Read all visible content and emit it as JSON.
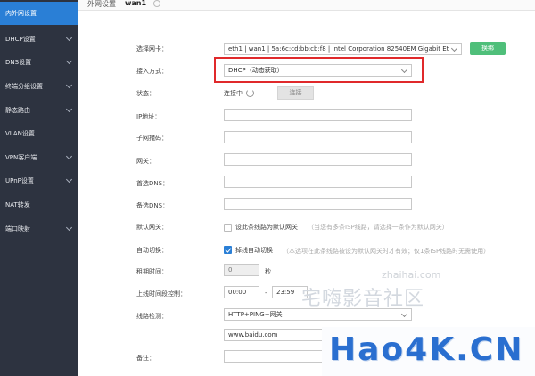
{
  "header": {
    "title": "外网设置",
    "wan": "wan1"
  },
  "sidebar": {
    "items": [
      {
        "label": "内外网设置",
        "active": true,
        "has_chevron": false
      },
      {
        "label": "DHCP设置",
        "has_chevron": true
      },
      {
        "label": "DNS设置",
        "has_chevron": true
      },
      {
        "label": "终端分组设置",
        "has_chevron": true
      },
      {
        "label": "静态路由",
        "has_chevron": true
      },
      {
        "label": "VLAN设置",
        "has_chevron": false
      },
      {
        "label": "VPN客户端",
        "has_chevron": true
      },
      {
        "label": "UPnP设置",
        "has_chevron": true
      },
      {
        "label": "NAT转发",
        "has_chevron": false
      },
      {
        "label": "端口映射",
        "has_chevron": true
      }
    ]
  },
  "form": {
    "nic": {
      "label": "选择网卡：",
      "value": "eth1 | wan1 | 5a:6c:cd:bb:cb:f8 | Intel Corporation 82540EM Gigabit Et",
      "button": "换绑"
    },
    "access": {
      "label": "接入方式：",
      "value": "DHCP（动态获取）"
    },
    "status": {
      "label": "状态：",
      "value": "连接中",
      "button": "连接"
    },
    "ip": {
      "label": "IP地址：",
      "value": ""
    },
    "mask": {
      "label": "子网掩码：",
      "value": ""
    },
    "gateway": {
      "label": "网关：",
      "value": ""
    },
    "dns1": {
      "label": "首选DNS：",
      "value": ""
    },
    "dns2": {
      "label": "备选DNS：",
      "value": ""
    },
    "default_gw": {
      "label": "默认网关：",
      "checkbox_label": "设此条线路为默认网关",
      "hint": "（当您有多条ISP线路，请选择一条作为默认网关）",
      "checked": false
    },
    "auto_switch": {
      "label": "自动切换：",
      "checkbox_label": "掉线自动切换",
      "hint": "（本选项在此条线路被设为默认网关时才有效；仅1条ISP线路时无需使用）",
      "checked": true
    },
    "lease": {
      "label": "租期时间：",
      "value": "0",
      "unit": "秒"
    },
    "online_time": {
      "label": "上线时间段控制：",
      "start": "00:00",
      "sep": "-",
      "end": "23:59"
    },
    "detect": {
      "label": "线路检测：",
      "value": "HTTP+PING+网关",
      "url": "www.baidu.com"
    },
    "remark": {
      "label": "备注：",
      "value": ""
    }
  },
  "watermarks": {
    "site": "zhaihai.com",
    "community": "宅嗨影音社区",
    "logo": "Hao4K.CN"
  }
}
